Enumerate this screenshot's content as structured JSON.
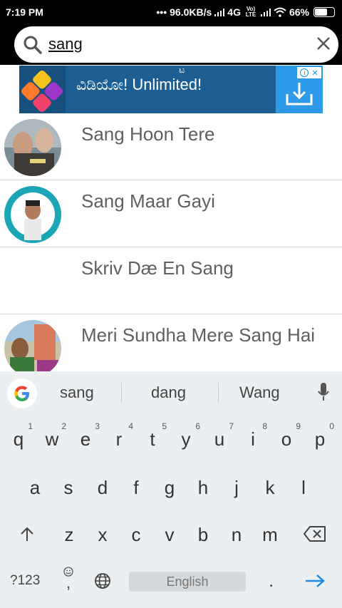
{
  "status_bar": {
    "time": "7:19 PM",
    "network_speed": "96.0KB/s",
    "network_type": "4G",
    "volte_label": "Vo) LTE",
    "battery": "66%",
    "battery_level": 0.66
  },
  "search": {
    "query": "sang",
    "search_icon": "search-icon",
    "clear_icon": "close-icon"
  },
  "ad": {
    "line1": "ಟ",
    "line2": "ವಿಡಿಯೋ! Unlimited!",
    "badge": "i",
    "close": "✕",
    "download_icon": "download-icon"
  },
  "results": [
    {
      "title": "Sang Hoon Tere",
      "has_thumb": true
    },
    {
      "title": "Sang Maar Gayi",
      "has_thumb": true
    },
    {
      "title": "Skriv Dæ En Sang",
      "has_thumb": false
    },
    {
      "title": "Meri Sundha Mere Sang Hai",
      "has_thumb": true
    }
  ],
  "keyboard": {
    "suggestions": [
      "sang",
      "dang",
      "Wang"
    ],
    "row1": [
      "q",
      "w",
      "e",
      "r",
      "t",
      "y",
      "u",
      "i",
      "o",
      "p"
    ],
    "row1_numbers": [
      "1",
      "2",
      "3",
      "4",
      "5",
      "6",
      "7",
      "8",
      "9",
      "0"
    ],
    "row2": [
      "a",
      "s",
      "d",
      "f",
      "g",
      "h",
      "j",
      "k",
      "l"
    ],
    "row3": [
      "z",
      "x",
      "c",
      "v",
      "b",
      "n",
      "m"
    ],
    "symbols_key": "?123",
    "comma": ",",
    "space_label": "English",
    "period": ".",
    "enter_icon": "arrow-right-icon",
    "shift_icon": "shift-icon",
    "backspace_icon": "backspace-icon",
    "emoji_icon": "emoji-icon",
    "globe_icon": "globe-icon",
    "mic_icon": "mic-icon",
    "google_icon": "google-icon"
  }
}
